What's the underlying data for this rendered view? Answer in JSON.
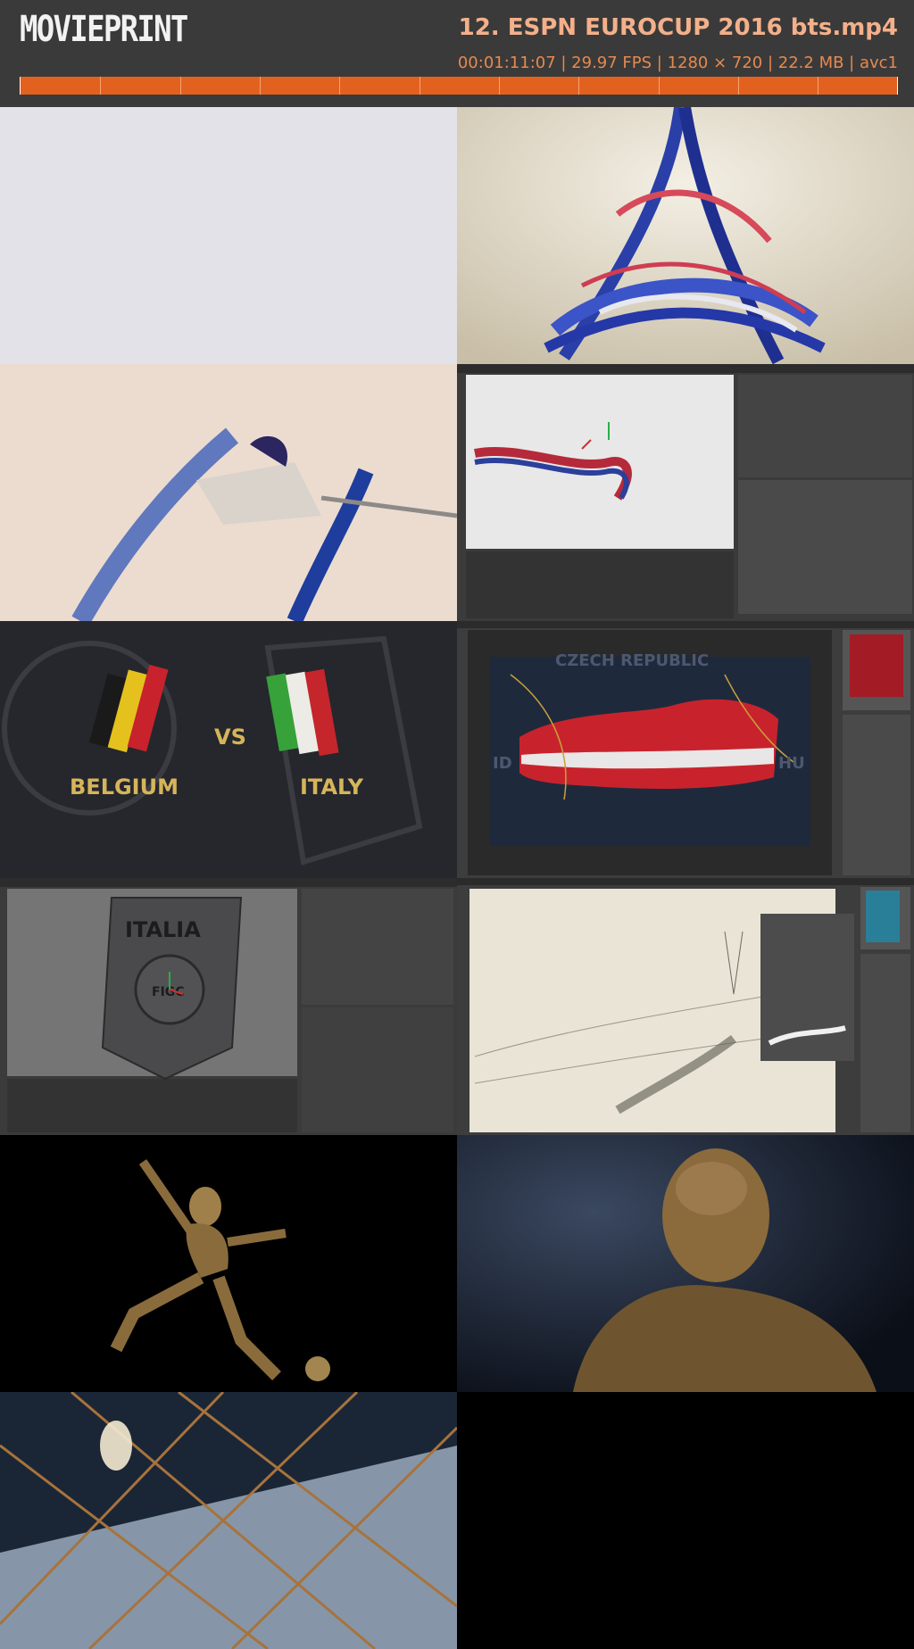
{
  "header": {
    "logo": "MOVIEPRINT",
    "file_title": "12. ESPN EUROCUP 2016 bts.mp4",
    "meta": "00:01:11:07 | 29.97 FPS | 1280 × 720 | 22.2 MB | avc1"
  },
  "frames": {
    "belgium_label": "BELGIUM",
    "vs_label": "VS",
    "italy_label": "ITALY",
    "italia_badge": "ITALIA",
    "figc_badge": "FIGC",
    "map_label_top": "CZECH REPUBLIC",
    "map_label_left": "ID",
    "map_label_right": "HU"
  },
  "colors": {
    "header_bg": "#3a3a3a",
    "title": "#f3b08a",
    "meta": "#e8894f",
    "timeline": "#e3611f"
  }
}
